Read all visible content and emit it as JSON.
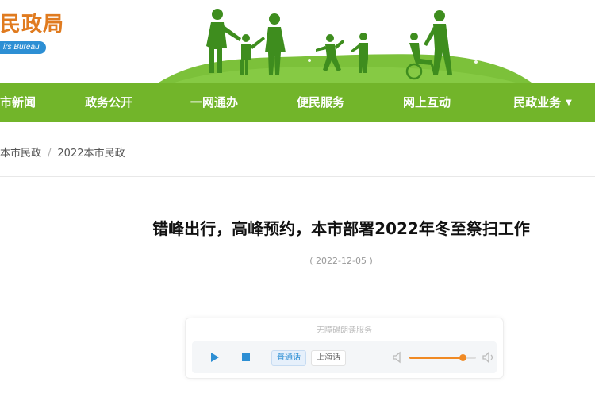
{
  "header": {
    "logo_title": "民政局",
    "logo_sub": "irs Bureau"
  },
  "nav": {
    "items": [
      {
        "label": "市新闻"
      },
      {
        "label": "政务公开"
      },
      {
        "label": "一网通办"
      },
      {
        "label": "便民服务"
      },
      {
        "label": "网上互动"
      },
      {
        "label": "民政业务"
      }
    ]
  },
  "breadcrumb": {
    "items": [
      "本市民政",
      "2022本市民政"
    ]
  },
  "article": {
    "title": "错峰出行，高峰预约，本市部署2022年冬至祭扫工作",
    "date": "( 2022-12-05 )"
  },
  "player": {
    "label": "无障碍朗读服务",
    "voice_1": "普通话",
    "voice_2": "上海话",
    "volume": 0.8
  },
  "colors": {
    "nav_green": "#72b52a",
    "logo_orange": "#e07b1f",
    "logo_blue": "#2d8fd4",
    "volume_accent": "#f08a24"
  }
}
